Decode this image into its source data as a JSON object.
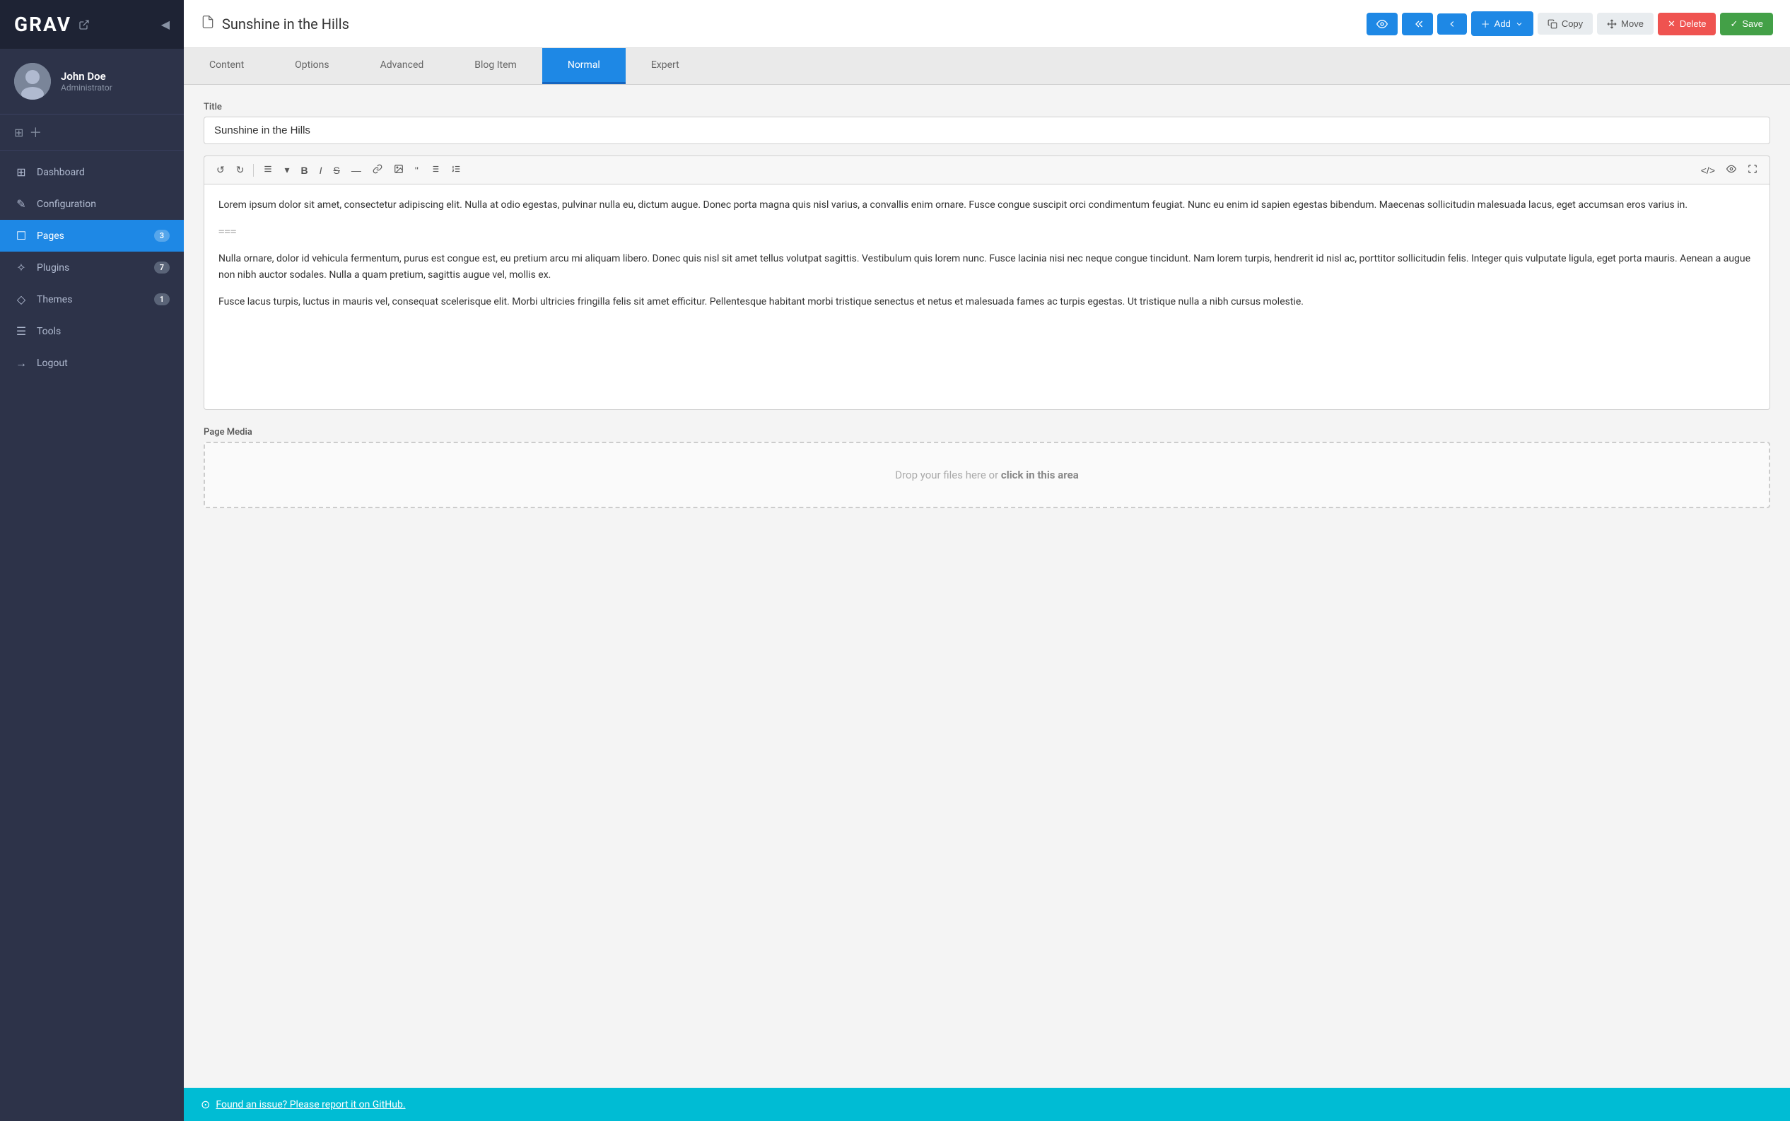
{
  "sidebar": {
    "logo": "GRAV",
    "user": {
      "name": "John Doe",
      "role": "Administrator"
    },
    "add_icon": "＋",
    "nav_items": [
      {
        "id": "dashboard",
        "icon": "⊞",
        "label": "Dashboard",
        "badge": null,
        "active": false
      },
      {
        "id": "configuration",
        "icon": "✎",
        "label": "Configuration",
        "badge": null,
        "active": false
      },
      {
        "id": "pages",
        "icon": "☐",
        "label": "Pages",
        "badge": "3",
        "active": true
      },
      {
        "id": "plugins",
        "icon": "✧",
        "label": "Plugins",
        "badge": "7",
        "active": false
      },
      {
        "id": "themes",
        "icon": "◇",
        "label": "Themes",
        "badge": "1",
        "active": false
      },
      {
        "id": "tools",
        "icon": "☰",
        "label": "Tools",
        "badge": null,
        "active": false
      },
      {
        "id": "logout",
        "icon": "→",
        "label": "Logout",
        "badge": null,
        "active": false
      }
    ]
  },
  "topbar": {
    "page_icon": "☐",
    "page_title": "Sunshine in the Hills",
    "actions": [
      {
        "id": "preview",
        "icon": "👁",
        "label": "",
        "style": "blue"
      },
      {
        "id": "back1",
        "icon": "←",
        "label": "",
        "style": "blue"
      },
      {
        "id": "back2",
        "icon": "‹",
        "label": "",
        "style": "blue"
      },
      {
        "id": "add",
        "icon": "＋",
        "label": "Add",
        "style": "blue",
        "has_dropdown": true
      },
      {
        "id": "copy",
        "icon": "⎘",
        "label": "Copy",
        "style": "gray"
      },
      {
        "id": "move",
        "icon": "⤢",
        "label": "Move",
        "style": "gray"
      },
      {
        "id": "delete",
        "icon": "✕",
        "label": "Delete",
        "style": "red"
      },
      {
        "id": "save",
        "icon": "✓",
        "label": "Save",
        "style": "green"
      }
    ]
  },
  "tabs": [
    {
      "id": "content",
      "label": "Content",
      "active": false
    },
    {
      "id": "options",
      "label": "Options",
      "active": false
    },
    {
      "id": "advanced",
      "label": "Advanced",
      "active": false
    },
    {
      "id": "blog-item",
      "label": "Blog Item",
      "active": false
    },
    {
      "id": "normal",
      "label": "Normal",
      "active": true
    },
    {
      "id": "expert",
      "label": "Expert",
      "active": false
    }
  ],
  "editor": {
    "title_label": "Title",
    "title_value": "Sunshine in the Hills",
    "body_paragraphs": [
      "Lorem ipsum dolor sit amet, consectetur adipiscing elit. Nulla at odio egestas, pulvinar nulla eu, dictum augue. Donec porta magna quis nisl varius, a convallis enim ornare. Fusce congue suscipit orci condimentum feugiat. Nunc eu enim id sapien egestas bibendum. Maecenas sollicitudin malesuada lacus, eget accumsan eros varius in.",
      "===",
      "Nulla ornare, dolor id vehicula fermentum, purus est congue est, eu pretium arcu mi aliquam libero. Donec quis nisl sit amet tellus volutpat sagittis. Vestibulum quis lorem nunc. Fusce lacinia nisi nec neque congue tincidunt. Nam lorem turpis, hendrerit id nisl ac, porttitor sollicitudin felis. Integer quis vulputate ligula, eget porta mauris. Aenean a augue non nibh auctor sodales. Nulla a quam pretium, sagittis augue vel, mollis ex.",
      "Fusce lacus turpis, luctus in mauris vel, consequat scelerisque elit. Morbi ultricies fringilla felis sit amet efficitur. Pellentesque habitant morbi tristique senectus et netus et malesuada fames ac turpis egestas. Ut tristique nulla a nibh cursus molestie."
    ],
    "media_label": "Page Media",
    "media_drop_text": "Drop your files here or ",
    "media_click_text": "click in this area"
  },
  "footer": {
    "icon": "⊙",
    "text": "Found an issue? Please report it on GitHub."
  }
}
